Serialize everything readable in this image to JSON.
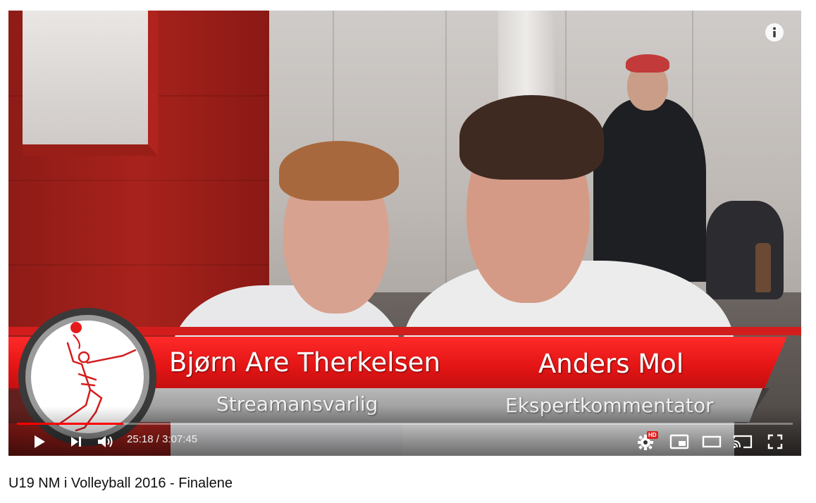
{
  "video": {
    "title": "U19 NM i Volleyball 2016 - Finalene",
    "progress_fraction": 0.137
  },
  "overlay": {
    "left_name": "Bjørn Are Therkelsen",
    "left_role": "Streamansvarlig",
    "right_name": "Anders Mol",
    "right_role": "Ekspertkommentator"
  },
  "controls": {
    "current_time": "25:18",
    "duration": "3:07:45",
    "quality_badge": "HD",
    "icons": {
      "play": "play-icon",
      "next": "next-icon",
      "volume": "volume-icon",
      "settings": "gear-icon",
      "miniplayer": "miniplayer-icon",
      "theater": "theater-icon",
      "cast": "cast-icon",
      "fullscreen": "fullscreen-icon",
      "info": "info-icon"
    }
  },
  "colors": {
    "accent": "#ff0000",
    "lower_third_red": "#e41515",
    "lower_third_grey": "#9e9e9e"
  }
}
